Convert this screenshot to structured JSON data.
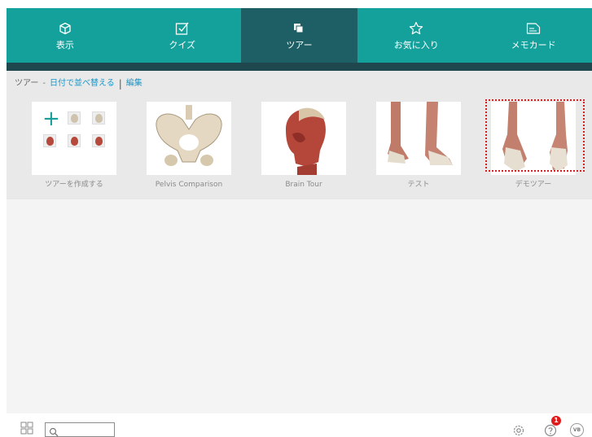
{
  "nav": {
    "tabs": [
      {
        "label": "表示",
        "icon": "cube-icon",
        "active": false
      },
      {
        "label": "クイズ",
        "icon": "checkbox-icon",
        "active": false
      },
      {
        "label": "ツアー",
        "icon": "layers-icon",
        "active": true
      },
      {
        "label": "お気に入り",
        "icon": "star-icon",
        "active": false
      },
      {
        "label": "メモカード",
        "icon": "notecard-icon",
        "active": false
      }
    ]
  },
  "breadcrumb": {
    "root": "ツアー",
    "separator": "-",
    "sort_label": "日付で並べ替える",
    "divider": "|",
    "edit_label": "編集"
  },
  "tours": [
    {
      "label": "ツアーを作成する",
      "thumb": "create-tour-icon"
    },
    {
      "label": "Pelvis Comparison",
      "thumb": "pelvis-image"
    },
    {
      "label": "Brain Tour",
      "thumb": "head-muscles-image"
    },
    {
      "label": "テスト",
      "thumb": "ankles-side-image"
    },
    {
      "label": "デモツアー",
      "thumb": "feet-front-image",
      "selected": true
    }
  ],
  "footer": {
    "search_placeholder": "",
    "help_badge": "1",
    "vb_label": "VB"
  },
  "colors": {
    "nav_bg": "#14a09b",
    "nav_active": "#1d5f64",
    "subbar": "#1e474e",
    "link": "#1996c8",
    "selection": "#d42020"
  }
}
